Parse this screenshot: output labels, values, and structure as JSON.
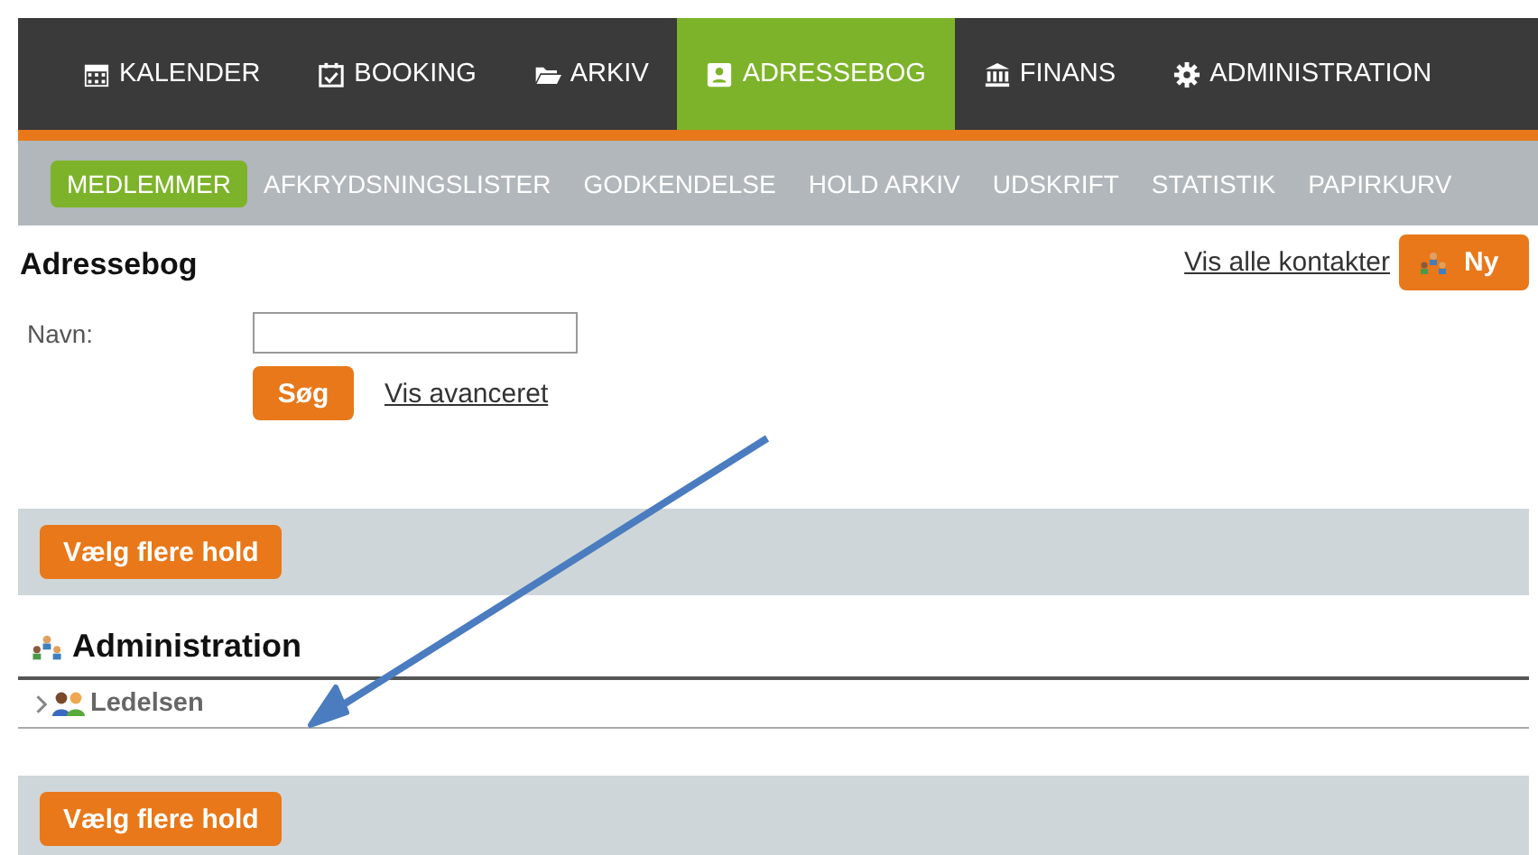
{
  "main_nav": [
    {
      "label": "KALENDER",
      "kind": "calendar",
      "selected": false
    },
    {
      "label": "BOOKING",
      "kind": "booking",
      "selected": false
    },
    {
      "label": "ARKIV",
      "kind": "archive",
      "selected": false
    },
    {
      "label": "ADRESSEBOG",
      "kind": "contacts",
      "selected": true
    },
    {
      "label": "FINANS",
      "kind": "finance",
      "selected": false
    },
    {
      "label": "ADMINISTRATION",
      "kind": "admin",
      "selected": false
    }
  ],
  "sub_nav": [
    {
      "label": "MEDLEMMER",
      "selected": true
    },
    {
      "label": "AFKRYDSNINGSLISTER",
      "selected": false
    },
    {
      "label": "GODKENDELSE",
      "selected": false
    },
    {
      "label": "HOLD ARKIV",
      "selected": false
    },
    {
      "label": "UDSKRIFT",
      "selected": false
    },
    {
      "label": "STATISTIK",
      "selected": false
    },
    {
      "label": "PAPIRKURV",
      "selected": false
    }
  ],
  "page_title": "Adressebog",
  "show_all_link": "Vis alle kontakter",
  "new_button": "Ny",
  "search": {
    "label": "Navn:",
    "button": "Søg",
    "advanced_link": "Vis avanceret"
  },
  "select_teams_button": "Vælg flere hold",
  "group": {
    "title": "Administration",
    "children": [
      {
        "label": "Ledelsen",
        "expanded": false
      }
    ]
  },
  "select_teams_button_bottom": "Vælg flere hold"
}
